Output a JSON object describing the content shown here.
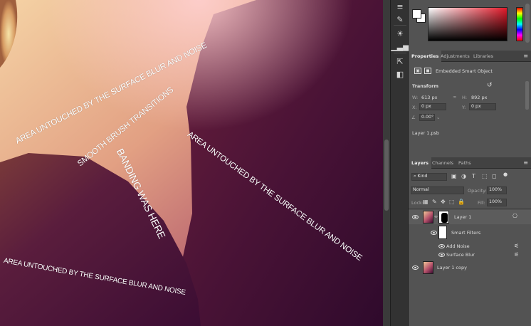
{
  "canvas": {
    "annotations": [
      "AREA UNTOUCHED BY THE SURFACE BLUR AND NOISE",
      "SMOOTH BRUSH TRANSITIONS",
      "BANDING WAS HERE",
      "AREA UNTOUCHED BY THE SURFACE BLUR AND NOISE",
      "AREA UNTOUCHED BY THE SURFACE BLUR AND NOISE"
    ]
  },
  "colors": {
    "panel_bg": "#535353",
    "tab_bar": "#424242",
    "picker_hue": "#e31a2a",
    "foreground": "#ffffff",
    "background": "#ffffff"
  },
  "toolstrip": {
    "icons": [
      "lines-icon",
      "pencil-icon",
      "swatches-icon",
      "sun-icon",
      "histogram-icon",
      "navigator-icon",
      "properties-icon"
    ]
  },
  "properties": {
    "tabs": [
      "Properties",
      "Adjustments",
      "Libraries"
    ],
    "object_type": "Embedded Smart Object",
    "transform_label": "Transform",
    "w_label": "W:",
    "w_value": "613 px",
    "h_label": "H:",
    "h_value": "892 px",
    "x_label": "X:",
    "x_value": "0 px",
    "y_label": "Y:",
    "y_value": "0 px",
    "angle_value": "0.00°",
    "filename": "Layer 1.psb"
  },
  "layers": {
    "tabs": [
      "Layers",
      "Channels",
      "Paths"
    ],
    "filter_kind": "Kind",
    "blend_mode": "Normal",
    "opacity_label": "Opacity:",
    "opacity_value": "100%",
    "lock_label": "Lock:",
    "fill_label": "Fill:",
    "fill_value": "100%",
    "items": [
      {
        "name": "Layer 1"
      },
      {
        "name": "Smart Filters"
      },
      {
        "name": "Add Noise"
      },
      {
        "name": "Surface Blur"
      },
      {
        "name": "Layer 1 copy"
      }
    ]
  }
}
